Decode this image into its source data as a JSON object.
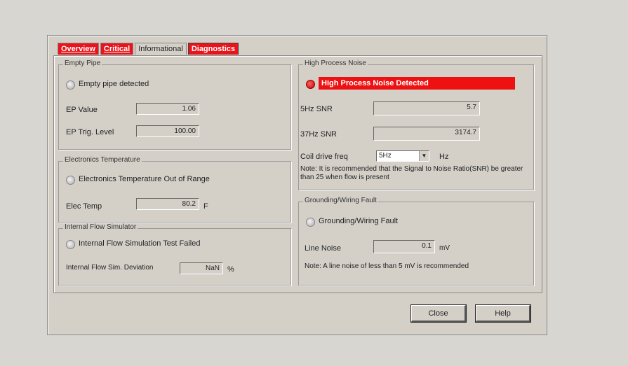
{
  "tabs": [
    {
      "label": "Overview"
    },
    {
      "label": "Critical"
    },
    {
      "label": "Informational"
    },
    {
      "label": "Diagnostics"
    }
  ],
  "empty_pipe": {
    "title": "Empty Pipe",
    "status_label": "Empty pipe detected",
    "ep_value_label": "EP Value",
    "ep_value": "1.06",
    "ep_trig_label": "EP Trig. Level",
    "ep_trig_value": "100.00"
  },
  "electronics_temp": {
    "title": "Electronics Temperature",
    "status_label": "Electronics Temperature Out of Range",
    "elec_temp_label": "Elec Temp",
    "elec_temp_value": "80.2",
    "unit": "F"
  },
  "flow_simulator": {
    "title": "Internal Flow Simulator",
    "status_label": "Internal Flow Simulation Test Failed",
    "deviation_label": "Internal Flow Sim. Deviation",
    "deviation_value": "NaN",
    "unit": "%"
  },
  "high_noise": {
    "title": "High Process Noise",
    "alert_label": "High Process Noise Detected",
    "snr5_label": "5Hz SNR",
    "snr5_value": "5.7",
    "snr37_label": "37Hz SNR",
    "snr37_value": "3174.7",
    "coil_label": "Coil drive freq",
    "coil_value": "5Hz",
    "coil_unit": "Hz",
    "note": "Note: It is recommended that the Signal to Noise Ratio(SNR) be greater than 25 when flow is present"
  },
  "grounding": {
    "title": "Grounding/Wiring Fault",
    "status_label": "Grounding/Wiring Fault",
    "line_noise_label": "Line Noise",
    "line_noise_value": "0.1",
    "unit": "mV",
    "note": "Note: A line noise of less than 5 mV is recommended"
  },
  "buttons": {
    "close": "Close",
    "help": "Help"
  }
}
